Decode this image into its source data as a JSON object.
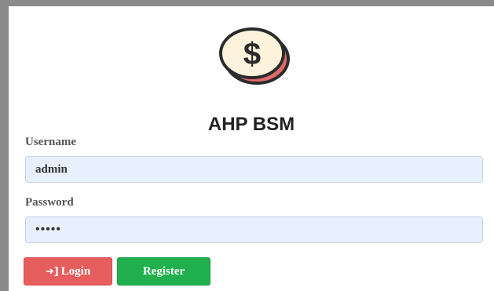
{
  "app": {
    "title": "AHP BSM",
    "logo_icon": "dollar-coin-icon",
    "logo_symbol": "$",
    "colors": {
      "coin_face": "#fdf3dc",
      "coin_edge": "#e06b6b",
      "coin_outline": "#2b2b2b"
    }
  },
  "form": {
    "username": {
      "label": "Username",
      "value": "admin"
    },
    "password": {
      "label": "Password",
      "value": "•••••"
    },
    "buttons": {
      "login": {
        "label": "Login",
        "icon": "sign-in-icon",
        "color": "#e55d5d"
      },
      "register": {
        "label": "Register",
        "color": "#20b04d"
      }
    }
  }
}
